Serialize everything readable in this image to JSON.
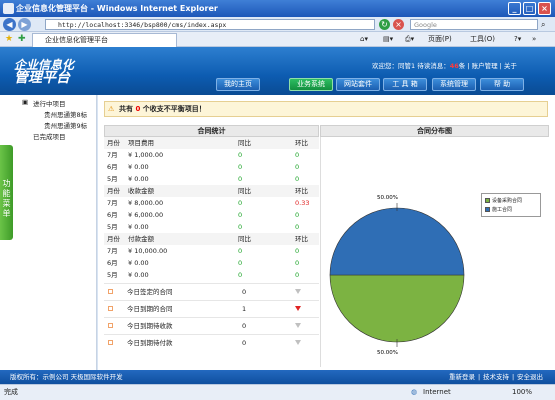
{
  "browser": {
    "window_title": "企业信息化管理平台 - Windows Internet Explorer",
    "url": "http://localhost:3346/bsp800/cms/index.aspx",
    "search_placeholder": "Google",
    "tab_title": "企业信息化管理平台",
    "tools": {
      "page": "页面(P)",
      "tools": "工具(O)"
    },
    "status_left": "完成",
    "status_zone": "Internet",
    "zoom": "100%"
  },
  "app": {
    "logo_line1": "企业信息化",
    "logo_line2": "管理平台",
    "welcome_prefix": "欢迎您：同管1 待读消息：",
    "unread_count": "46",
    "unread_suffix": "条",
    "account_link": "账户管理",
    "about_link": "关于",
    "nav": [
      "我的主页",
      "业务系统",
      "网站套件",
      "工 具 箱",
      "系统管理",
      "帮 助"
    ],
    "active_nav": "业务系统"
  },
  "sidebar": {
    "handle_label": "功能菜单",
    "items": [
      "进行中项目",
      "贵州思通第8标",
      "贵州思通第9标",
      "已完成项目"
    ]
  },
  "alert": {
    "prefix": "共有",
    "count": "0",
    "suffix": "个收支不平衡项目！"
  },
  "contract_stats": {
    "title": "合同统计",
    "sections": [
      {
        "header": [
          "月份",
          "项目费用",
          "同比",
          "环比"
        ],
        "rows": [
          [
            "7月",
            "¥ 1,000.00",
            "0",
            "0"
          ],
          [
            "6月",
            "¥ 0.00",
            "0",
            "0"
          ],
          [
            "5月",
            "¥ 0.00",
            "0",
            "0"
          ]
        ]
      },
      {
        "header": [
          "月份",
          "收款金额",
          "同比",
          "环比"
        ],
        "rows": [
          [
            "7月",
            "¥ 8,000.00",
            "0",
            "0.33"
          ],
          [
            "6月",
            "¥ 6,000.00",
            "0",
            "0"
          ],
          [
            "5月",
            "¥ 0.00",
            "0",
            "0"
          ]
        ]
      },
      {
        "header": [
          "月份",
          "付款金额",
          "同比",
          "环比"
        ],
        "rows": [
          [
            "7月",
            "¥ 10,000.00",
            "0",
            "0"
          ],
          [
            "6月",
            "¥ 0.00",
            "0",
            "0"
          ],
          [
            "5月",
            "¥ 0.00",
            "0",
            "0"
          ]
        ]
      }
    ],
    "today": [
      {
        "label": "今日签定的合同",
        "value": "0"
      },
      {
        "label": "今日到期的合同",
        "value": "1"
      },
      {
        "label": "今日到期待收款",
        "value": "0"
      },
      {
        "label": "今日到期待付款",
        "value": "0"
      }
    ]
  },
  "chart_data": {
    "type": "pie",
    "title": "合同分布图",
    "labels": [
      "设备采购合同",
      "施工合同"
    ],
    "values": [
      50,
      50
    ],
    "data_labels": [
      "50.00%",
      "50.00%"
    ],
    "colors": [
      "#7cb342",
      "#2f6eb5"
    ],
    "legend": "right"
  },
  "footer": {
    "left": "版权所有：示例公司  天极国际软件开发",
    "links": [
      "重新登录",
      "技术支持",
      "安全退出"
    ]
  }
}
